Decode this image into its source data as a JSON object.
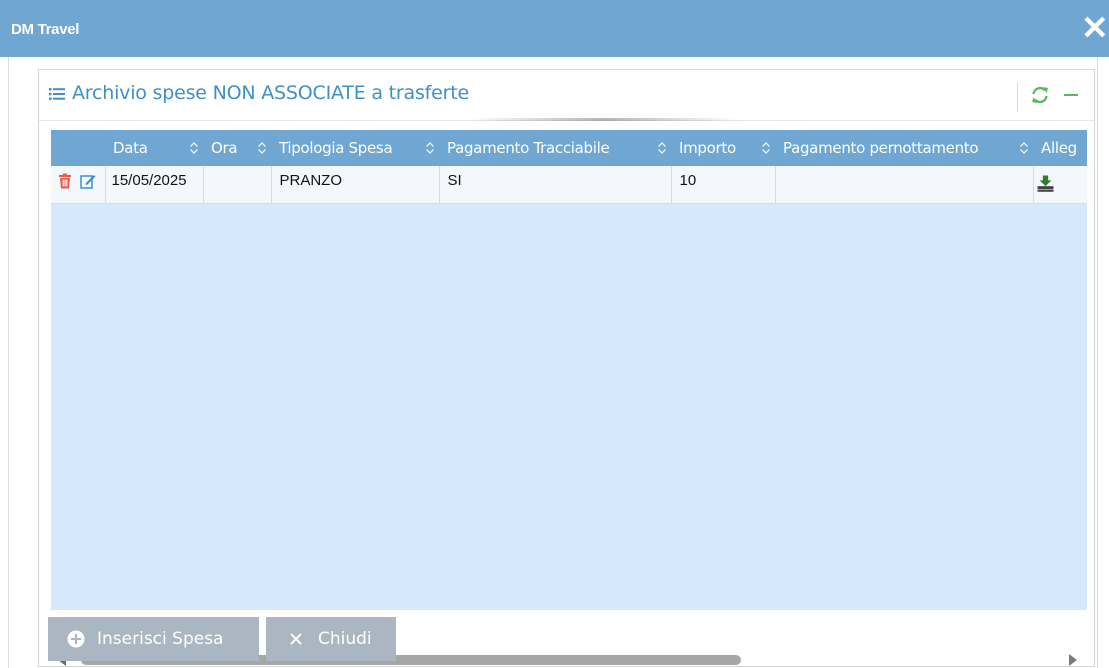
{
  "window": {
    "title": "DM Travel"
  },
  "panel": {
    "title": "Archivio spese NON ASSOCIATE a trasferte"
  },
  "grid": {
    "columns": [
      "Data",
      "Ora",
      "Tipologia Spesa",
      "Pagamento Tracciabile",
      "Importo",
      "Pagamento pernottamento",
      "Alleg"
    ],
    "rows": [
      {
        "data": "15/05/2025",
        "ora": "",
        "tipologia": "PRANZO",
        "tracciabile": "SI",
        "importo": "10",
        "pernottamento": ""
      }
    ]
  },
  "buttons": {
    "add_label": "Inserisci Spesa",
    "close_label": "Chiudi"
  },
  "icons": [
    "list-icon",
    "refresh-icon",
    "collapse-icon",
    "trash-icon",
    "edit-icon",
    "download-icon",
    "close-icon",
    "plus-circle-icon",
    "times-icon"
  ],
  "colors": {
    "titlebar": "#6fa7d2",
    "grid_bg": "#d6e8fb",
    "accent_title": "#3f8fc8",
    "refresh": "#5cb85c",
    "delete": "#e55a4f",
    "button": "#aab6c1"
  }
}
